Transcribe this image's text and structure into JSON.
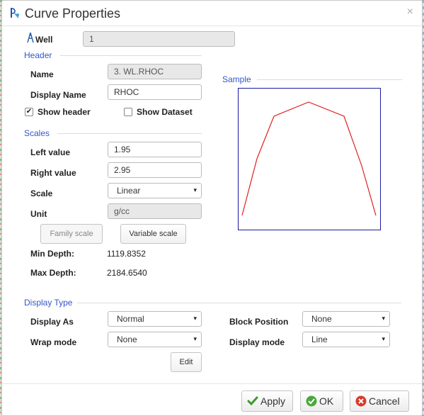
{
  "dialog": {
    "title": "Curve Properties",
    "close_label": "×"
  },
  "well": {
    "label": "Well",
    "value": "1"
  },
  "header": {
    "section": "Header",
    "name_label": "Name",
    "name_value": "3. WL.RHOC",
    "display_name_label": "Display Name",
    "display_name_value": "RHOC",
    "show_header_label": "Show header",
    "show_header_checked": true,
    "show_dataset_label": "Show Dataset",
    "show_dataset_checked": false
  },
  "scales": {
    "section": "Scales",
    "left_label": "Left value",
    "left_value": "1.95",
    "right_label": "Right value",
    "right_value": "2.95",
    "scale_label": "Scale",
    "scale_value": "Linear",
    "unit_label": "Unit",
    "unit_value": "g/cc",
    "family_scale_btn": "Family scale",
    "variable_scale_btn": "Variable scale",
    "min_depth_label": "Min Depth:",
    "min_depth_value": "1119.8352",
    "max_depth_label": "Max Depth:",
    "max_depth_value": "2184.6540"
  },
  "sample": {
    "section": "Sample",
    "line_color": "#e02020",
    "border_color": "#1a1aa0"
  },
  "display_type": {
    "section": "Display Type",
    "display_as_label": "Display As",
    "display_as_value": "Normal",
    "wrap_mode_label": "Wrap mode",
    "wrap_mode_value": "None",
    "edit_btn": "Edit",
    "block_position_label": "Block Position",
    "block_position_value": "None",
    "display_mode_label": "Display mode",
    "display_mode_value": "Line"
  },
  "footer": {
    "apply": "Apply",
    "ok": "OK",
    "cancel": "Cancel"
  },
  "icons": {
    "title": "well-curve-icon",
    "well": "well-rig-icon",
    "apply": "check-icon",
    "ok": "ok-circle-icon",
    "cancel": "cancel-circle-icon",
    "caret": "▾",
    "check": "✔"
  }
}
